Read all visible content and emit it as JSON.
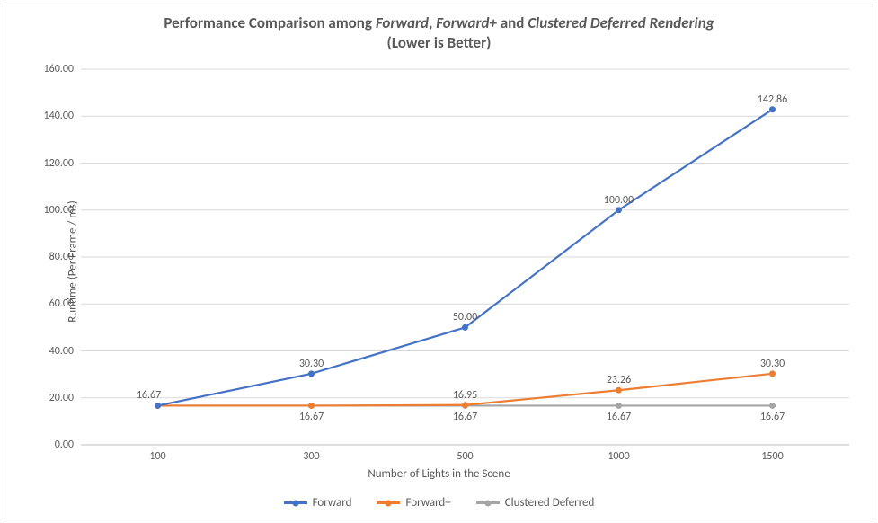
{
  "chart_data": {
    "type": "line",
    "title_parts": {
      "prefix": "Performance Comparison among ",
      "s1": "Forward",
      "sep1": ", ",
      "s2": "Forward+",
      "sep2": " and ",
      "s3": "Clustered Deferred Rendering",
      "line2": "(Lower is Better)"
    },
    "xlabel": "Number of Lights in the Scene",
    "ylabel": "Runtime (Per Frame / ms)",
    "categories": [
      "100",
      "300",
      "500",
      "1000",
      "1500"
    ],
    "ylim": [
      0,
      160
    ],
    "yticks": [
      "0.00",
      "20.00",
      "40.00",
      "60.00",
      "80.00",
      "100.00",
      "120.00",
      "140.00",
      "160.00"
    ],
    "series": [
      {
        "name": "Forward",
        "color": "#4472c4",
        "values": [
          16.67,
          30.3,
          50.0,
          100.0,
          142.86
        ],
        "labels": [
          "16.67",
          "30.30",
          "50.00",
          "100.00",
          "142.86"
        ]
      },
      {
        "name": "Forward+",
        "color": "#ed7d31",
        "values": [
          16.67,
          16.67,
          16.95,
          23.26,
          30.3
        ],
        "labels": [
          "",
          "",
          "16.95",
          "23.26",
          "30.30"
        ]
      },
      {
        "name": "Clustered Deferred",
        "color": "#a5a5a5",
        "values": [
          16.67,
          16.67,
          16.67,
          16.67,
          16.67
        ],
        "labels": [
          "",
          "16.67",
          "16.67",
          "16.67",
          "16.67"
        ]
      }
    ],
    "legend": [
      "Forward",
      "Forward+",
      "Clustered Deferred"
    ]
  }
}
